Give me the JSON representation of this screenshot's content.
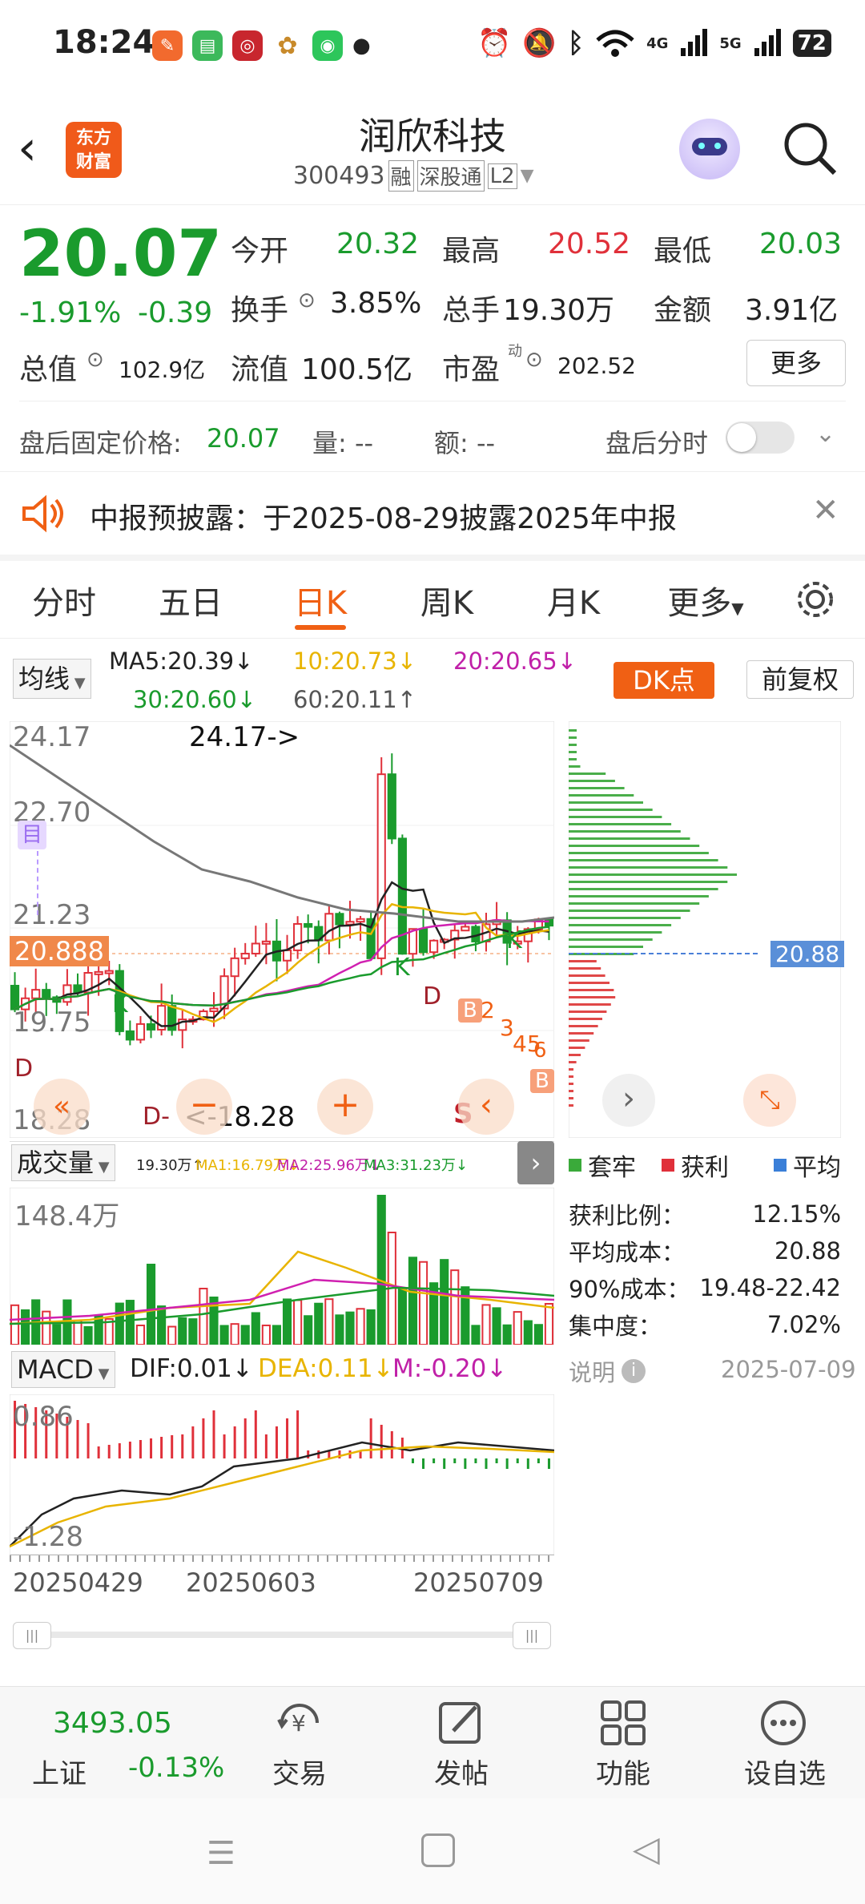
{
  "status_bar": {
    "time": "18:24",
    "net1": "4G",
    "net2": "5G",
    "battery": "72"
  },
  "header": {
    "title": "润欣科技",
    "code": "300493",
    "badge1": "融",
    "badge2": "深股通",
    "badge3": "L2",
    "logo_text1": "东方",
    "logo_text2": "财富"
  },
  "quote": {
    "price": "20.07",
    "change_pct": "-1.91%",
    "change": "-0.39",
    "open_label": "今开",
    "open": "20.32",
    "high_label": "最高",
    "high": "20.52",
    "low_label": "最低",
    "low": "20.03",
    "turnover_label": "换手",
    "turnover": "3.85%",
    "volume_label": "总手",
    "volume": "19.30万",
    "amount_label": "金额",
    "amount": "3.91亿",
    "mktcap_label": "总值",
    "mktcap": "102.9亿",
    "float_label": "流值",
    "float_cap": "100.5亿",
    "pe_label": "市盈",
    "pe_sup": "动",
    "pe": "202.52",
    "more_button": "更多"
  },
  "after_hours": {
    "label": "盘后固定价格:",
    "price": "20.07",
    "vol_label": "量: --",
    "amt_label": "额: --",
    "toggle_label": "盘后分时"
  },
  "notice": {
    "text": "中报预披露：于2025-08-29披露2025年中报"
  },
  "tabs": [
    "分时",
    "五日",
    "日K",
    "周K",
    "月K",
    "更多"
  ],
  "active_tab": "日K",
  "ma_bar": {
    "selector": "均线",
    "ma5": "MA5:20.39↓",
    "ma10": "10:20.73↓",
    "ma20": "20:20.65↓",
    "ma30": "30:20.60↓",
    "ma60": "60:20.11↑",
    "dk_button": "DK点",
    "adjust_button": "前复权"
  },
  "kline": {
    "y_labels": [
      "24.17",
      "22.70",
      "21.23",
      "19.75",
      "18.28"
    ],
    "current_price_tag": "20.888",
    "high_marker": "24.17->",
    "low_marker": "<-18.28",
    "mark_mu": "目",
    "signals": [
      "K",
      "K",
      "K",
      "D",
      "D",
      "D-",
      "S",
      "B",
      "B",
      "B",
      "2",
      "3",
      "45",
      "6"
    ]
  },
  "chip_dist": {
    "price_tag": "20.88",
    "legend": [
      "套牢",
      "获利",
      "平均"
    ],
    "rows": [
      {
        "label": "获利比例：",
        "value": "12.15%"
      },
      {
        "label": "平均成本：",
        "value": "20.88"
      },
      {
        "label": "90%成本：",
        "value": "19.48-22.42"
      },
      {
        "label": "集中度：",
        "value": "7.02%"
      }
    ],
    "note_label": "说明",
    "date": "2025-07-09"
  },
  "volume_panel": {
    "selector": "成交量",
    "v_total": "19.30万↑",
    "ma1": "MA1:16.79万↓",
    "ma2": "MA2:25.96万↓",
    "ma3": "MA3:31.23万↓",
    "max_label": "148.4万"
  },
  "macd_panel": {
    "selector": "MACD",
    "dif": "DIF:0.01↓",
    "dea": "DEA:0.11↓",
    "m": "M:-0.20↓",
    "top_label": "0.86",
    "bottom_label": "-1.28"
  },
  "x_axis": [
    "20250429",
    "20250603",
    "20250709"
  ],
  "bottom_nav": {
    "index_value": "3493.05",
    "index_name": "上证",
    "index_change": "-0.13%",
    "items": [
      "交易",
      "发帖",
      "功能",
      "设自选"
    ]
  },
  "colors": {
    "up": "#e0303a",
    "down": "#1a9b2d",
    "accent": "#f06014",
    "ma5": "#222222",
    "ma10": "#e8b400",
    "ma20": "#d020b0",
    "ma30": "#1a9b2d",
    "ma60": "#777777"
  }
}
